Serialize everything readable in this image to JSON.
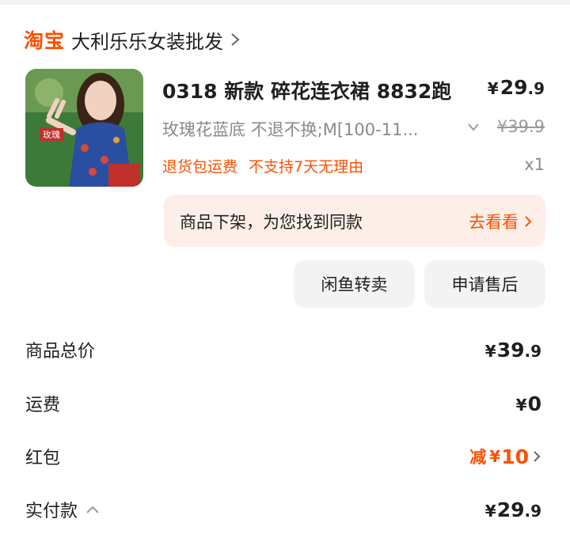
{
  "shop": {
    "logo": "淘宝",
    "name": "大利乐乐女装批发"
  },
  "item": {
    "title": "0318 新款 碎花连衣裙 8832跑",
    "price_int": "29",
    "price_dec": ".9",
    "currency": "¥",
    "spec": "玫瑰花蓝底 不退不换;M[100-11...",
    "original_price": "¥39.9",
    "tags": [
      "退货包运费",
      "不支持7天无理由"
    ],
    "quantity": "x1",
    "image_text": "玫瑰"
  },
  "off_shelf": {
    "message": "商品下架，为您找到同款",
    "link": "去看看"
  },
  "actions": {
    "resell": "闲鱼转卖",
    "after_sale": "申请售后"
  },
  "summary": {
    "goods_total": {
      "label": "商品总价",
      "currency": "¥",
      "int": "39",
      "dec": ".9"
    },
    "shipping": {
      "label": "运费",
      "currency": "¥",
      "int": "0"
    },
    "red_packet": {
      "label": "红包",
      "prefix": "减",
      "currency": "¥",
      "int": "10"
    },
    "paid": {
      "label": "实付款",
      "currency": "¥",
      "int": "29",
      "dec": ".9"
    }
  },
  "colors": {
    "accent": "#ff5000",
    "offshelf_bg": "#fdefe8",
    "button_bg": "#f3f3f3",
    "muted_text": "#8a8a8a"
  },
  "icons": [
    "chevron-right-icon",
    "chevron-down-icon",
    "chevron-up-icon"
  ]
}
